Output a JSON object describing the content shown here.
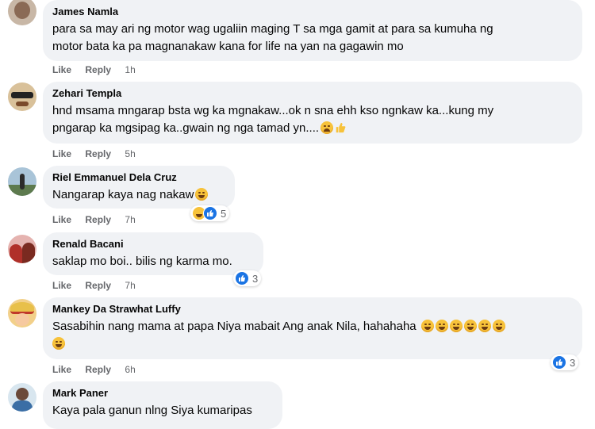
{
  "comments": [
    {
      "author": "James Namla",
      "line1": "para sa may ari ng motor wag ugaliin maging T sa mga gamit at para sa kumuha ng",
      "line2": "motor bata ka pa magnanakaw kana for life na yan na gagawin mo",
      "like": "Like",
      "reply": "Reply",
      "time": "1h"
    },
    {
      "author": "Zehari Templa",
      "line1": "hnd msama mngarap bsta wg ka mgnakaw...ok n sna ehh kso ngnkaw ka...kung my",
      "line2": "pngarap ka mgsipag ka..gwain ng nga tamad yn....",
      "like": "Like",
      "reply": "Reply",
      "time": "5h"
    },
    {
      "author": "Riel Emmanuel Dela Cruz",
      "line1": "Nangarap kaya nag nakaw",
      "like": "Like",
      "reply": "Reply",
      "time": "7h",
      "reactions": "5"
    },
    {
      "author": "Renald Bacani",
      "line1": "saklap mo boi.. bilis ng karma mo.",
      "like": "Like",
      "reply": "Reply",
      "time": "7h",
      "reactions": "3"
    },
    {
      "author": "Mankey Da Strawhat Luffy",
      "line1": "Sasabihin nang mama at papa Niya mabait Ang anak Nila, hahahaha",
      "like": "Like",
      "reply": "Reply",
      "time": "6h",
      "reactions": "3"
    },
    {
      "author": "Mark Paner",
      "line1": "Kaya pala ganun nlng Siya kumaripas"
    }
  ],
  "colors": {
    "bubble": "#f0f2f5",
    "meta": "#65676b",
    "like_blue": "#1b74e4",
    "haha": "#f7c23a"
  }
}
